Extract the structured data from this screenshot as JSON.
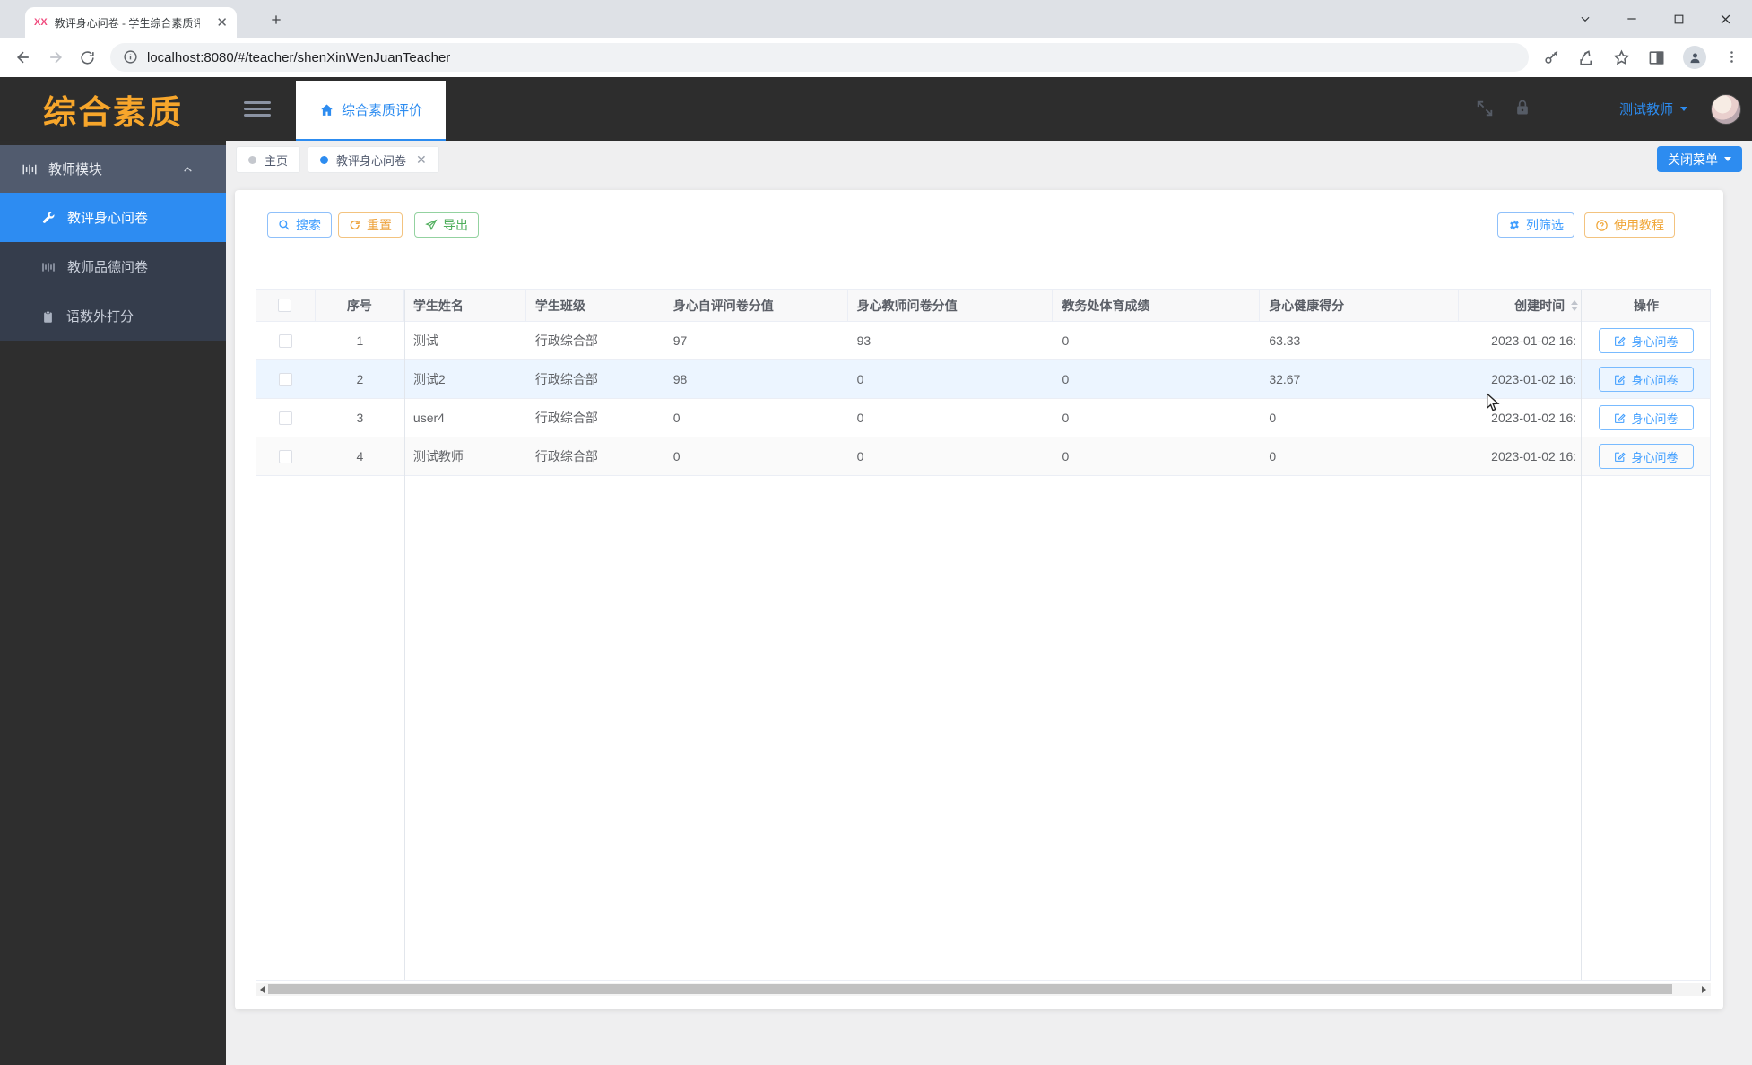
{
  "browser": {
    "active_tab_title": "教评身心问卷 - 学生综合素质评",
    "favicon_text": "XX",
    "url": "localhost:8080/#/teacher/shenXinWenJuanTeacher"
  },
  "app_header": {
    "logo": "综合素质",
    "nav_tab": "综合素质评价",
    "username": "测试教师"
  },
  "sidebar": {
    "items": [
      {
        "label": "教师模块",
        "type": "parent",
        "expanded": true
      },
      {
        "label": "教评身心问卷",
        "active": true
      },
      {
        "label": "教师品德问卷",
        "active": false
      },
      {
        "label": "语数外打分",
        "active": false
      }
    ]
  },
  "page_tabs": [
    {
      "label": "主页",
      "active": false
    },
    {
      "label": "教评身心问卷",
      "active": true,
      "closable": true
    }
  ],
  "close_menu_button": "关闭菜单",
  "toolbar": {
    "search": "搜索",
    "reset": "重置",
    "export": "导出",
    "column_filter": "列筛选",
    "tutorial": "使用教程"
  },
  "table": {
    "headers": {
      "index": "序号",
      "student_name": "学生姓名",
      "student_class": "学生班级",
      "self_score": "身心自评问卷分值",
      "teacher_score": "身心教师问卷分值",
      "pe_score": "教务处体育成绩",
      "health_score": "身心健康得分",
      "created": "创建时间",
      "action": "操作"
    },
    "action_label": "身心问卷",
    "rows": [
      {
        "index": "1",
        "student_name": "测试",
        "student_class": "行政综合部",
        "self_score": "97",
        "teacher_score": "93",
        "pe_score": "0",
        "health_score": "63.33",
        "created": "2023-01-02 16:",
        "hovered": false
      },
      {
        "index": "2",
        "student_name": "测试2",
        "student_class": "行政综合部",
        "self_score": "98",
        "teacher_score": "0",
        "pe_score": "0",
        "health_score": "32.67",
        "created": "2023-01-02 16:",
        "hovered": true
      },
      {
        "index": "3",
        "student_name": "user4",
        "student_class": "行政综合部",
        "self_score": "0",
        "teacher_score": "0",
        "pe_score": "0",
        "health_score": "0",
        "created": "2023-01-02 16:",
        "hovered": false
      },
      {
        "index": "4",
        "student_name": "测试教师",
        "student_class": "行政综合部",
        "self_score": "0",
        "teacher_score": "0",
        "pe_score": "0",
        "health_score": "0",
        "created": "2023-01-02 16:",
        "hovered": false
      }
    ]
  },
  "colors": {
    "accent_blue": "#2d8cf0",
    "button_blue": "#409eff",
    "warning_orange": "#eda23c",
    "success_green": "#4fae5c",
    "logo_orange": "#f7a62b",
    "sidebar_active": "#2d8cf2",
    "hover_row_bg": "#ecf5ff"
  },
  "icons": {
    "favicon": "XX",
    "search": "magnifier",
    "reset": "refresh-circle",
    "export": "paper-plane",
    "column_filter": "gear",
    "tutorial": "question-circle",
    "action": "edit-square",
    "sidebar_parent": "barcode",
    "sidebar_active": "wrench",
    "sidebar_item3": "clipboard",
    "header": [
      "fullscreen",
      "lock",
      "caret-down"
    ],
    "nav_tab": "home"
  }
}
